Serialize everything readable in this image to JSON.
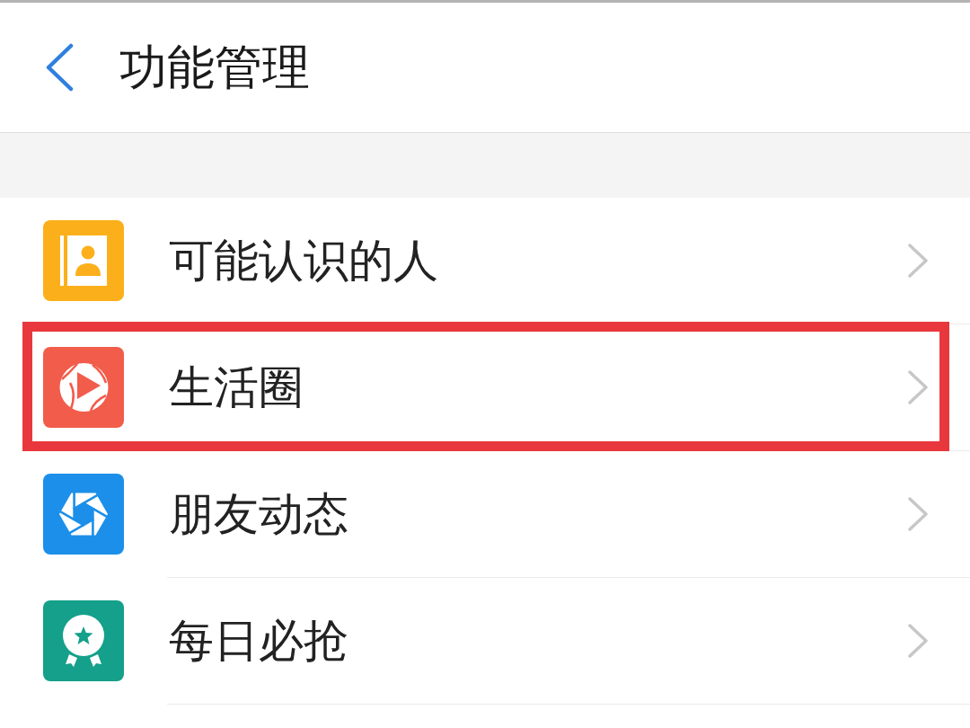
{
  "header": {
    "title": "功能管理"
  },
  "items": [
    {
      "kind": "contacts",
      "color": "#fbb01b",
      "label": "可能认识的人",
      "highlighted": false
    },
    {
      "kind": "play",
      "color": "#f25c4b",
      "label": "生活圈",
      "highlighted": true
    },
    {
      "kind": "aperture",
      "color": "#1b8fe9",
      "label": "朋友动态",
      "highlighted": false
    },
    {
      "kind": "award",
      "color": "#14a08a",
      "label": "每日必抢",
      "highlighted": false
    }
  ]
}
